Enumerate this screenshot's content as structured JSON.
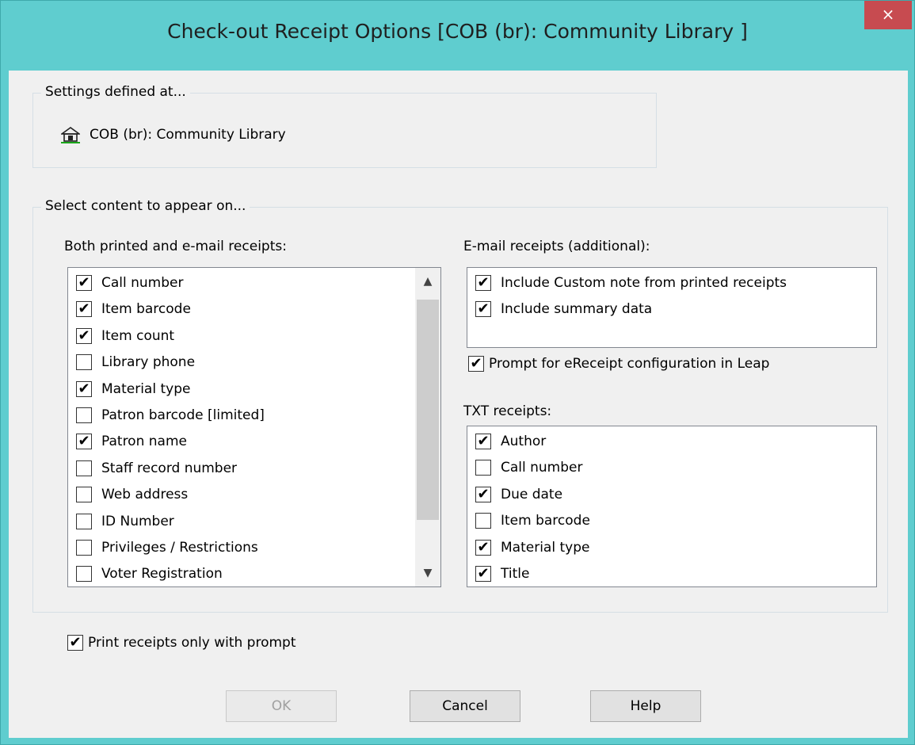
{
  "window": {
    "title": "Check-out Receipt Options [COB (br): Community Library ]",
    "close_label": "×"
  },
  "settings": {
    "group_label": "Settings defined at...",
    "site_icon": "library-building-icon",
    "site_name": "COB (br): Community Library"
  },
  "content": {
    "group_label": "Select content to appear on...",
    "both": {
      "label": "Both printed and e-mail receipts:",
      "items": [
        {
          "label": "Call number",
          "checked": true
        },
        {
          "label": "Item barcode",
          "checked": true
        },
        {
          "label": "Item count",
          "checked": true
        },
        {
          "label": "Library phone",
          "checked": false
        },
        {
          "label": "Material type",
          "checked": true
        },
        {
          "label": "Patron barcode [limited]",
          "checked": false
        },
        {
          "label": "Patron name",
          "checked": true
        },
        {
          "label": "Staff record number",
          "checked": false
        },
        {
          "label": "Web address",
          "checked": false
        },
        {
          "label": "ID Number",
          "checked": false
        },
        {
          "label": "Privileges / Restrictions",
          "checked": false
        },
        {
          "label": "Voter Registration",
          "checked": false
        }
      ]
    },
    "email": {
      "label": "E-mail receipts (additional):",
      "items": [
        {
          "label": "Include Custom note from printed receipts",
          "checked": true
        },
        {
          "label": "Include summary data",
          "checked": true
        }
      ]
    },
    "ereceipt_prompt": {
      "label": "Prompt for eReceipt configuration in Leap",
      "checked": true
    },
    "txt": {
      "label": "TXT receipts:",
      "items": [
        {
          "label": "Author",
          "checked": true
        },
        {
          "label": "Call number",
          "checked": false
        },
        {
          "label": "Due date",
          "checked": true
        },
        {
          "label": "Item barcode",
          "checked": false
        },
        {
          "label": "Material type",
          "checked": true
        },
        {
          "label": "Title",
          "checked": true
        }
      ]
    }
  },
  "print_prompt": {
    "label": "Print receipts only with prompt",
    "checked": true
  },
  "buttons": {
    "ok": "OK",
    "cancel": "Cancel",
    "help": "Help"
  },
  "colors": {
    "title_bar": "#5fcdcf",
    "close_button": "#c74b50",
    "client_background": "#f0f0f0"
  }
}
